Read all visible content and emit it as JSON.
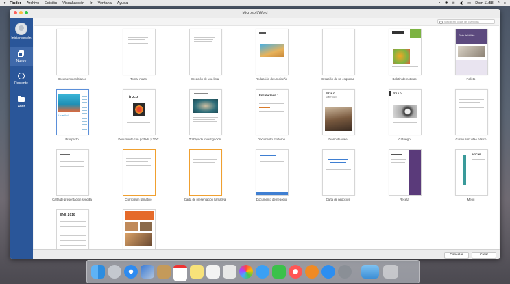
{
  "menubar": {
    "apple": "",
    "items": [
      "Finder",
      "Archivo",
      "Edición",
      "Visualización",
      "Ir",
      "Ventana",
      "Ayuda"
    ],
    "clock": "Dom 11:58"
  },
  "window": {
    "title": "Microsoft Word",
    "search_placeholder": "Buscar en todas las plantillas"
  },
  "sidebar": {
    "items": [
      {
        "label": "Iniciar sesión",
        "icon": "user-avatar-icon"
      },
      {
        "label": "Nuevo",
        "icon": "new-document-icon",
        "active": true
      },
      {
        "label": "Reciente",
        "icon": "clock-icon"
      },
      {
        "label": "Abrir",
        "icon": "folder-icon"
      }
    ]
  },
  "templates": [
    {
      "label": "Documento en blanco"
    },
    {
      "label": "Tomar notas"
    },
    {
      "label": "Creación de una lista"
    },
    {
      "label": "Redacción de un diseño"
    },
    {
      "label": "Creación de un esquema"
    },
    {
      "label": "Boletín de noticias"
    },
    {
      "label": "Folleto"
    },
    {
      "label": "Prospecto"
    },
    {
      "label": "Documento con portada y TDC"
    },
    {
      "label": "Trabajo de investigación"
    },
    {
      "label": "Documento moderno"
    },
    {
      "label": "Diario de viaje"
    },
    {
      "label": "Catálogo"
    },
    {
      "label": "Currículum vitae básico"
    },
    {
      "label": "Carta de presentación sencilla"
    },
    {
      "label": "Currículum llamativo"
    },
    {
      "label": "Carta de presentación llamativa"
    },
    {
      "label": "Documento de negocio"
    },
    {
      "label": "Carta de negocios"
    },
    {
      "label": "Receta"
    },
    {
      "label": "Menú"
    },
    {
      "label": ""
    },
    {
      "label": ""
    }
  ],
  "thumb_text": {
    "folleto_title": "Título del folleto",
    "prospecto_title": "Un anillo!",
    "titulo": "TÍTULO",
    "titulo_sub": "SUBTÍTULO",
    "encabezado": "Encabezado 1",
    "calendar": "ENE 2018",
    "menu_title": "NOCHE"
  },
  "buttons": {
    "cancel": "Cancelar",
    "create": "Crear"
  },
  "colors": {
    "sidebar": "#2a5699",
    "selection": "#5b8fd9"
  }
}
